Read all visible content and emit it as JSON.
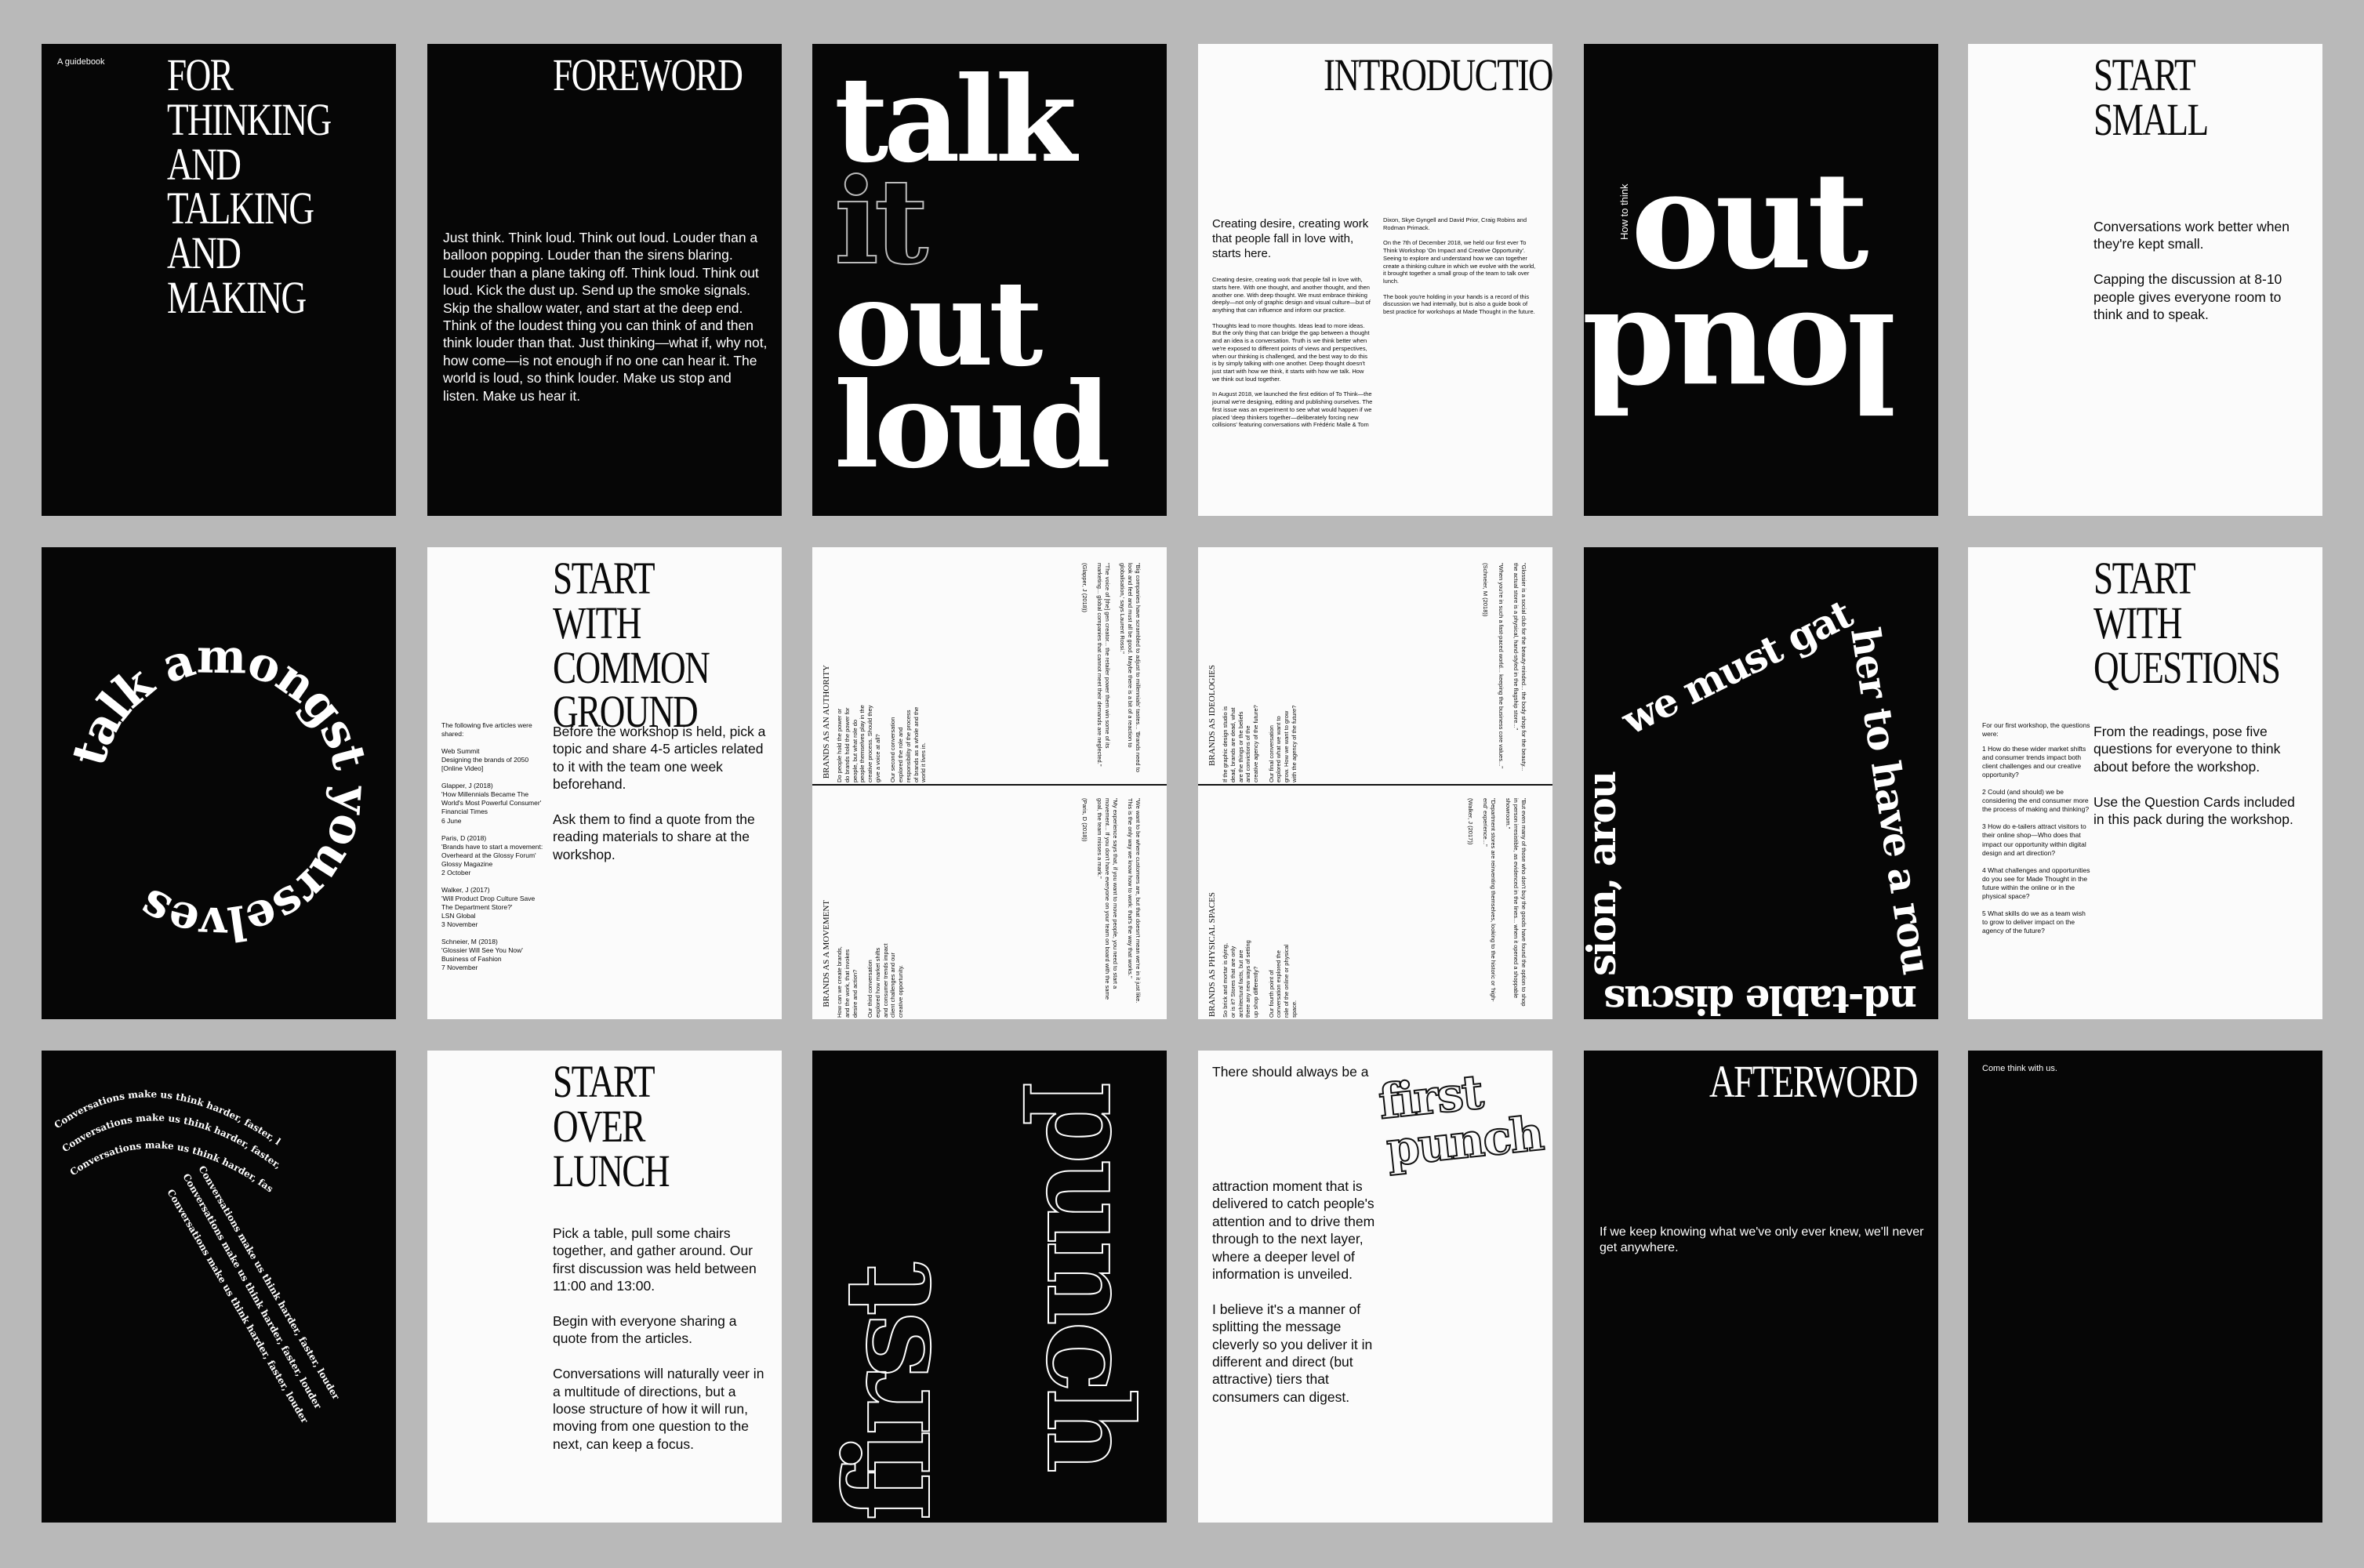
{
  "p1": {
    "tag": "A guidebook",
    "title": "FOR THINKING\nAND TALKING\nAND MAKING"
  },
  "p2": {
    "title": "FOREWORD",
    "body": "Just think. Think loud. Think out loud. Louder than a balloon popping. Louder than the sirens blaring. Louder than a plane taking off. Think loud. Think out loud. Kick the dust up. Send up the smoke signals. Skip the shallow water, and start at the deep end. Think of the loudest thing you can think of and then think louder than that. Just thinking—what if, why not, how come—is not enough if no one can hear it. The world is loud, so think louder. Make us stop and listen. Make us hear it."
  },
  "p3": {
    "w1": "talk",
    "w2": "it",
    "w3": "out",
    "w4": "loud"
  },
  "p4": {
    "title": "INTRODUCTION",
    "lead": "Creating desire, creating work that people fall in love with, starts here.",
    "col1": "Creating desire, creating work that people fall in love with, starts here. With one thought, and another thought, and then another one. With deep thought. We must embrace thinking deeply—not only of graphic design and visual culture—but of anything that can influence and inform our practice.\n\nThoughts lead to more thoughts. Ideas lead to more ideas. But the only thing that can bridge the gap between a thought and an idea is a conversation. Truth is we think better when we're exposed to different points of views and perspectives, when our thinking is challenged, and the best way to do this is by simply talking with one another. Deep thought doesn't just start with how we think, it starts with how we talk. How we think out loud together.\n\nIn August 2018, we launched the first edition of To Think—the journal we're designing, editing and publishing ourselves. The first issue was an experiment to see what would happen if we placed 'deep thinkers together—deliberately forcing new collisions' featuring conversations with Frédéric Malle & Tom",
    "col2": "Dixon, Skye Gyngell and David Prior, Craig Robins and Rodman Primack.\n\nOn the 7th of December 2018, we held our first ever To Think Workshop 'On Impact and Creative Opportunity'. Seeing to explore and understand how we can together create a thinking culture in which we evolve with the world, it brought together a small group of the team to talk over lunch.\n\nThe book you're holding in your hands is a record of this discussion we had internally, but is also a guide book of best practice for workshops at Made Thought in the future."
  },
  "p5": {
    "side": "How to think",
    "w1": "out",
    "w2": "loud"
  },
  "p6": {
    "title": "START SMALL",
    "body": "Conversations work better when they're kept small.\n\nCapping the discussion at 8-10 people gives everyone room to think and to speak."
  },
  "p7": {
    "circle": "talk amongst yourselves"
  },
  "p8": {
    "title": "START WITH\nCOMMON\nGROUND",
    "refs": "The following five articles were shared:\n\nWeb Summit\nDesigning the brands of 2050\n[Online Video]\n\nGlapper, J (2018)\n'How Millennials Became The World's Most Powerful Consumer'\nFinancial Times\n6 June\n\nParis, D (2018)\n'Brands have to start a movement: Overheard at the Glossy Forum'\nGlossy Magazine\n2 October\n\nWalker, J (2017)\n'Will Product Drop Culture Save The Department Store?'\nLSN Global\n3 November\n\nSchneier, M (2018)\n'Glossier Will See You Now'\nBusiness of Fashion\n7 November",
    "body": "Before the workshop is held, pick a topic and share 4-5 articles related to it with the team one week beforehand.\n\nAsk them to find a quote from the reading materials to share at the workshop."
  },
  "p9": {
    "h1": "BRANDS AS AN AUTHORITY",
    "h2": "BRANDS AS A MOVEMENT",
    "t1": "Do people hold the power or do brands hold the power for people, but what role do people themselves play in the creative process. Should they give a voice at all?\n\nOur second conversation explored the role and responsibility of the process of brands as a whole and the world it lives in.",
    "t2": "How can we create brands, and the work, that invokes desire and action?\n\nOur third conversation explored how market shifts and consumer trends impact client challenges and our creative opportunity.",
    "q1": "\"Big companies have scrambled to adjust to millennials' tastes... 'Brands need to look and feel and must all be good. Maybe there is a bit of a reaction to globalisation,' says Laurent Rossi.\"\n\n\"The voice of [the] gen creator... the retailer power them win some of its marketing... global companies that cannot meet their demands are neglected.\"\n\n(Glapper, J (2018))",
    "q2": "\"We want to be where customers are, but that doesn't mean we're in it just like. This is the only way we know how to work: that's the way that works.\"\n\n\"My experience says that, if you want to move people, you need to start a movement... If you don't have everyone on your team on board with the same goal, the team misses a mark.\"\n\n(Paris, D (2018))"
  },
  "p10": {
    "h1": "BRANDS AS IDEOLOGIES",
    "h2": "BRANDS AS PHYSICAL SPACES",
    "t1": "If the graphic design studio is dead, brands are dead, what are the things or the beliefs and convictions of the creative agency of the future?\n\nOur final conversation explored what we want to grow. How we want to grow with the agency of the future?",
    "t2": "So brick and mortar is dying, or is it? Stores that are only architectural facts, but are there any new ways of setting up shop differently?\n\nOur fourth point of conversation explored the role of the online or physical space.",
    "q1": "\"Glossier is a social club for the beauty-minded... the body shop for the beauty... the actual store is a physical, hand-styled in the flagship store...\"\n\n\"When you're in such a fast-paced world... keeping the business core values...\"\n\n(Schneier, M (2018))",
    "q2": "\"But even many of those who don't buy the goods have found the option to shop in person irresistible, as evidenced in the lines... when it opened a shoppable showroom.\"\n\n\"Department stores are reinventing themselves, looking to the historic or 'high-end' experience...\"\n\n(Walker, J (2017))"
  },
  "p11": {
    "text": "we must gather to have a round-table discussion, around a common theme"
  },
  "p12": {
    "title": "START WITH\nQUESTIONS",
    "intro": "For our first workshop, the questions were:",
    "q": "1  How do these wider market shifts and consumer trends impact both client challenges and our creative opportunity?\n\n2  Could (and should) we be considering the end consumer more the process of making and thinking?\n\n3  How do e-tailers attract visitors to their online shop—Who does that impact our opportunity within digital design and art direction?\n\n4  What challenges and opportunities do you see for Made Thought in the future within the online or in the physical space?\n\n5  What skills do we as a team wish to grow to deliver impact on the agency of the future?",
    "body": "From the readings, pose five questions for everyone to think about before the workshop.\n\nUse the Question Cards included in this pack during the workshop."
  },
  "p13": {
    "words": "Conversations make us think harder, faster, louder"
  },
  "p14": {
    "title": "START OVER\nLUNCH",
    "body": "Pick a table, pull some chairs together, and gather around. Our first discussion was held between 11:00 and 13:00.\n\nBegin with everyone sharing a quote from the articles.\n\nConversations will naturally veer in a multitude of directions, but a loose structure of how it will run, moving from one question to the next, can keep a focus."
  },
  "p15": {
    "w1": "first",
    "w2": "punch"
  },
  "p16": {
    "top": "There should always be a",
    "w1": "first",
    "w2": "punch",
    "body": "attraction moment that is delivered to catch people's attention and to drive them through to the next layer, where a deeper level of information is unveiled.\n\nI believe it's a manner of splitting the message cleverly so you deliver it in different and direct (but attractive) tiers that consumers can digest."
  },
  "p17": {
    "title": "AFTERWORD",
    "body": "If we keep knowing what we've only ever knew, we'll never get anywhere."
  },
  "p18": {
    "tag": "Come think with us."
  }
}
